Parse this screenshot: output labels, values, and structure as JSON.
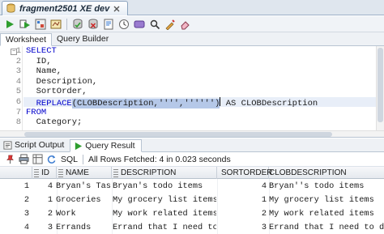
{
  "document_tab": {
    "title": "fragment2501 XE dev"
  },
  "toolbar": {
    "buttons": [
      "run-statement-icon",
      "run-script-icon",
      "explain-plan-icon",
      "autotrace-icon",
      "commit-icon",
      "rollback-icon",
      "clear-icon",
      "history-icon",
      "sql-tuning-icon",
      "find-icon",
      "format-icon",
      "eraser-icon"
    ]
  },
  "worksheet_tabs": [
    {
      "label": "Worksheet"
    },
    {
      "label": "Query Builder"
    }
  ],
  "editor": {
    "lines": [
      {
        "no": "1",
        "text": "SELECT"
      },
      {
        "no": "2",
        "text": "  ID,"
      },
      {
        "no": "3",
        "text": "  Name,"
      },
      {
        "no": "4",
        "text": "  Description,"
      },
      {
        "no": "5",
        "text": "  SortOrder,"
      },
      {
        "no": "6",
        "text_pre": "  ",
        "text_kw": "REPLACE",
        "text_mid": "(CLOBDescription,'''','''''')",
        "text_post": " AS CLOBDescription"
      },
      {
        "no": "7",
        "text": "FROM"
      },
      {
        "no": "8",
        "text": "  Category;"
      }
    ]
  },
  "output_tabs": [
    {
      "label": "Script Output"
    },
    {
      "label": "Query Result"
    }
  ],
  "result_toolbar": {
    "sql_label": "SQL",
    "status": "All Rows Fetched: 4 in 0.023 seconds"
  },
  "grid": {
    "columns": [
      "ID",
      "NAME",
      "DESCRIPTION",
      "SORTORDER",
      "CLOBDESCRIPTION"
    ],
    "rows": [
      {
        "rownum": "1",
        "id": "4",
        "name": "Bryan's Tasks",
        "description": "Bryan's todo items",
        "sortorder": "4",
        "clob": "Bryan''s todo items"
      },
      {
        "rownum": "2",
        "id": "1",
        "name": "Groceries",
        "description": "My grocery list items",
        "sortorder": "1",
        "clob": "My grocery list items"
      },
      {
        "rownum": "3",
        "id": "2",
        "name": "Work",
        "description": "My work related items",
        "sortorder": "2",
        "clob": "My work related items"
      },
      {
        "rownum": "4",
        "id": "3",
        "name": "Errands",
        "description": "Errand that I need to do",
        "sortorder": "3",
        "clob": "Errand that I need to do"
      }
    ]
  },
  "colors": {
    "keyword": "#0000cc",
    "tab_strip": "#dfe6ee",
    "run_green": "#2f9e2f"
  }
}
